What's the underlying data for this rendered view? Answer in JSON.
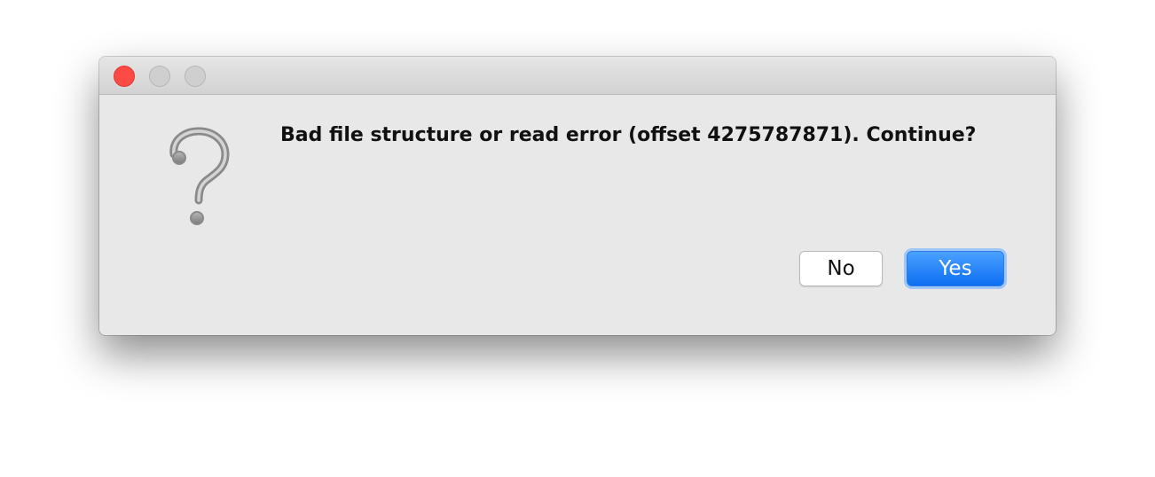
{
  "window": {
    "traffic_lights": {
      "close_color": "#fc4a45",
      "inactive_color": "#cfcfcf"
    }
  },
  "dialog": {
    "icon": "question-mark-icon",
    "message": "Bad file structure or read error (offset 4275787871). Continue?",
    "buttons": {
      "no_label": "No",
      "yes_label": "Yes"
    },
    "accent_color": "#0d6ef2"
  }
}
